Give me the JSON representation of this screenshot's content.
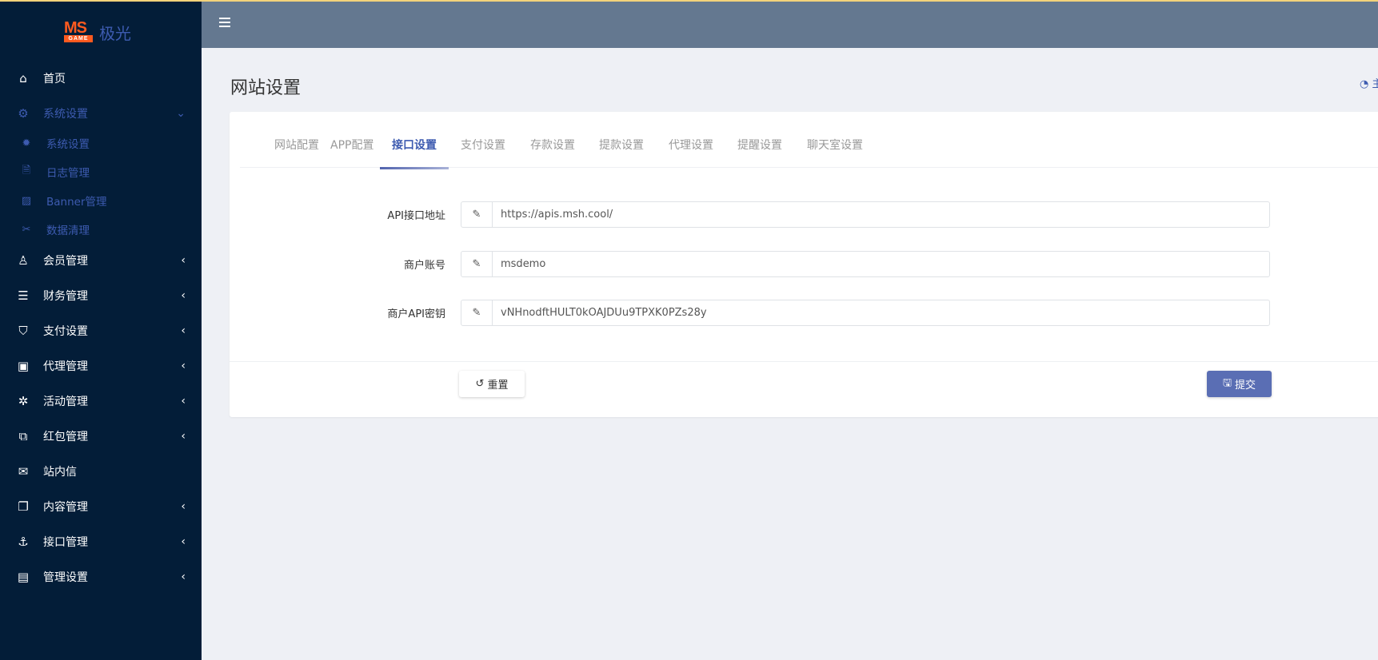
{
  "brand": {
    "logo_mark": "MS",
    "logo_sub": "GAME",
    "name": "极光"
  },
  "sidebar": {
    "items": [
      {
        "label": "首页",
        "icon": "home-icon",
        "glyph": "⌂"
      },
      {
        "label": "系统设置",
        "icon": "gears-icon",
        "glyph": "⚙",
        "expanded": true,
        "children": [
          {
            "label": "系统设置",
            "icon": "gear-icon",
            "glyph": "✹"
          },
          {
            "label": "日志管理",
            "icon": "file-icon",
            "glyph": "🗎"
          },
          {
            "label": "Banner管理",
            "icon": "image-icon",
            "glyph": "▨"
          },
          {
            "label": "数据清理",
            "icon": "scissors-icon",
            "glyph": "✂"
          }
        ]
      },
      {
        "label": "会员管理",
        "icon": "user-icon",
        "glyph": "♙"
      },
      {
        "label": "财务管理",
        "icon": "database-icon",
        "glyph": "☰"
      },
      {
        "label": "支付设置",
        "icon": "bookmark-icon",
        "glyph": "⛉"
      },
      {
        "label": "代理管理",
        "icon": "contact-book-icon",
        "glyph": "▣"
      },
      {
        "label": "活动管理",
        "icon": "yelp-icon",
        "glyph": "✲"
      },
      {
        "label": "红包管理",
        "icon": "clone-icon",
        "glyph": "⧉"
      },
      {
        "label": "站内信",
        "icon": "envelope-icon",
        "glyph": "✉"
      },
      {
        "label": "内容管理",
        "icon": "copy-icon",
        "glyph": "❐"
      },
      {
        "label": "接口管理",
        "icon": "anchor-icon",
        "glyph": "⚓"
      },
      {
        "label": "管理设置",
        "icon": "id-card-icon",
        "glyph": "▤"
      }
    ]
  },
  "page": {
    "title": "网站设置",
    "breadcrumb": "主页"
  },
  "tabs": [
    "网站配置",
    "APP配置",
    "接口设置",
    "支付设置",
    "存款设置",
    "提款设置",
    "代理设置",
    "提醒设置",
    "聊天室设置"
  ],
  "active_tab": "接口设置",
  "form": {
    "fields": [
      {
        "label": "API接口地址",
        "value": "https://apis.msh.cool/"
      },
      {
        "label": "商户账号",
        "value": "msdemo"
      },
      {
        "label": "商户API密钥",
        "value": "vNHnodftHULT0kOAJDUu9TPXK0PZs28y"
      }
    ],
    "reset_label": "重置",
    "submit_label": "提交"
  },
  "colors": {
    "sidebar": "#031d38",
    "header": "#647890",
    "accent": "#5a6eb4",
    "background": "#eef0f5"
  }
}
